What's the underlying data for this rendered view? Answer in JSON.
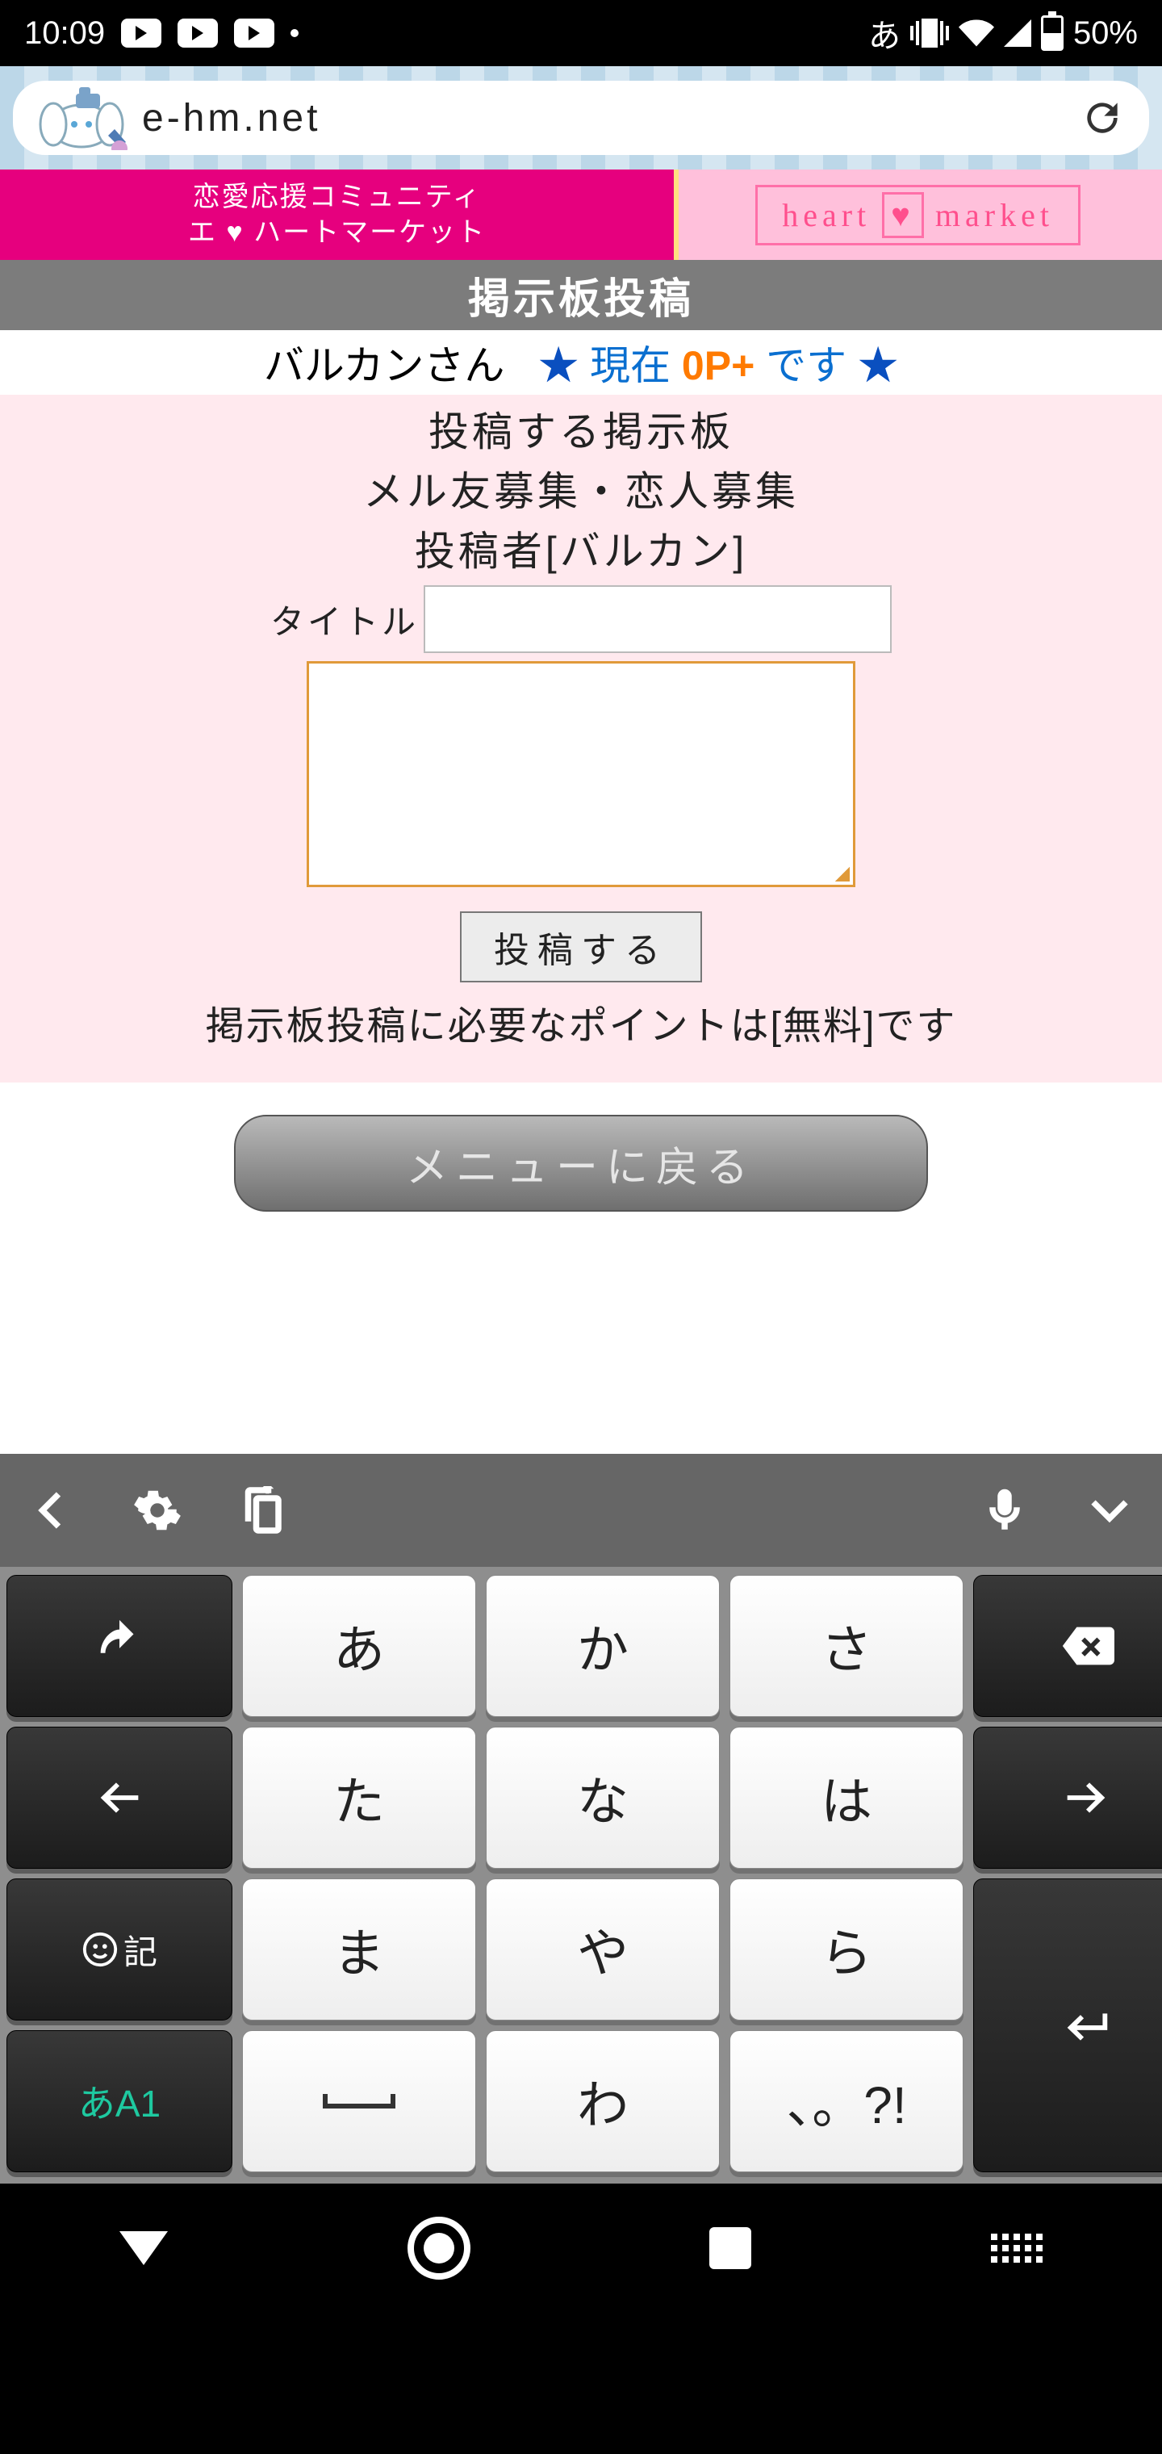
{
  "status_bar": {
    "time": "10:09",
    "ime": "あ",
    "battery_pct": "50%"
  },
  "browser": {
    "url": "e-hm.net"
  },
  "banner": {
    "tagline1": "恋愛応援コミュニティ",
    "tagline2": "エ ♥ ハートマーケット",
    "logo_left": "heart",
    "logo_heart": "♥",
    "logo_right": "market"
  },
  "page": {
    "title": "掲示板投稿",
    "user_prefix": "バルカンさん",
    "status_pre": "現在",
    "status_points": "0P+",
    "status_post": "です",
    "board_heading": "投稿する掲示板",
    "board_name": "メル友募集・恋人募集",
    "poster_label": "投稿者[バルカン]",
    "title_label": "タイトル",
    "title_value": "",
    "body_value": "",
    "submit_label": "投稿する",
    "cost_line": "掲示板投稿に必要なポイントは[無料]です",
    "menu_back": "メニューに戻る"
  },
  "keyboard": {
    "rows": {
      "r1": [
        "あ",
        "か",
        "さ"
      ],
      "r2": [
        "た",
        "な",
        "は"
      ],
      "r3": [
        "ま",
        "や",
        "ら"
      ],
      "r4_mid": "わ",
      "r4_punct": "、。?!"
    },
    "emoji_label": "記",
    "mode_label": "あA1"
  }
}
